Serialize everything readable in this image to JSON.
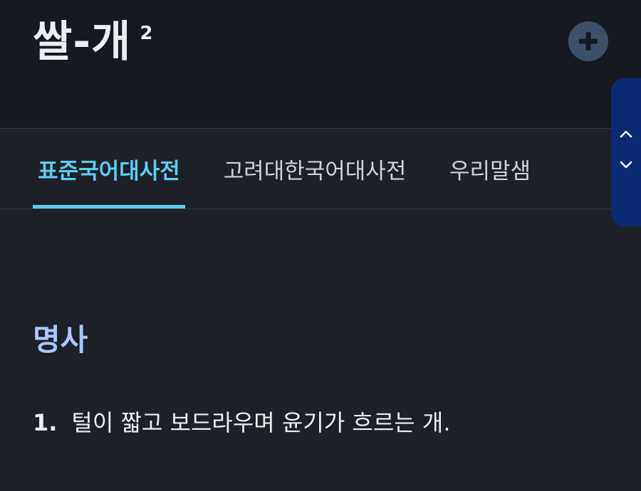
{
  "entry": {
    "word": "쌀-개",
    "homograph_number": "2"
  },
  "header": {
    "add_icon": "plus-circle-icon"
  },
  "tabs": [
    {
      "label": "표준국어대사전",
      "active": true
    },
    {
      "label": "고려대한국어대사전",
      "active": false
    },
    {
      "label": "우리말샘",
      "active": false
    }
  ],
  "side_nav": {
    "up_icon": "chevron-up-icon",
    "down_icon": "chevron-down-icon"
  },
  "sense": {
    "part_of_speech": "명사",
    "definitions": [
      {
        "number": "1.",
        "text": "털이 짧고 보드라우며 윤기가 흐르는 개."
      }
    ]
  },
  "colors": {
    "background": "#1e2027",
    "header_background": "#171921",
    "accent": "#5ccdf1",
    "pos_label": "#a9c6ff",
    "side_nav": "#0a2a73",
    "add_button": "#3e5068"
  }
}
